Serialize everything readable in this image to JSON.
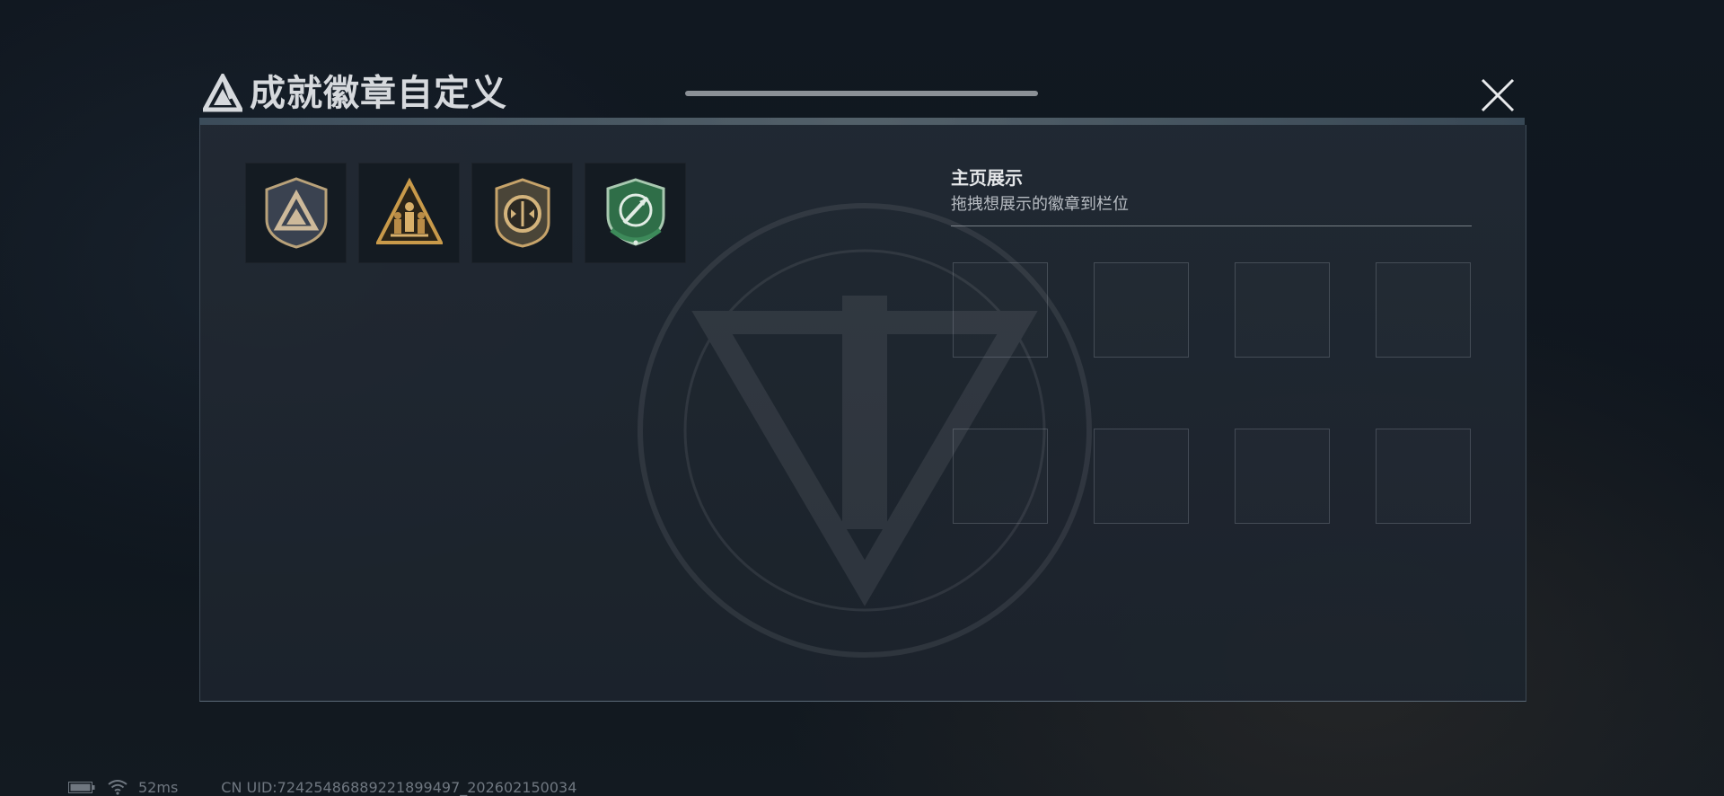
{
  "dialog": {
    "title": "成就徽章自定义",
    "close_icon": "close-icon",
    "logo_icon": "triangle-logo-icon"
  },
  "badges": [
    {
      "name": "triangle-shield-badge",
      "color": "#b9a27a"
    },
    {
      "name": "soldiers-triangle-badge",
      "color": "#c99a4a"
    },
    {
      "name": "oval-emblem-badge",
      "color": "#c6a36a"
    },
    {
      "name": "green-crest-badge",
      "color": "#3d8a5a"
    }
  ],
  "showcase": {
    "title": "主页展示",
    "subtitle": "拖拽想展示的徽章到栏位",
    "slots": 8
  },
  "status": {
    "ping": "52ms",
    "uid": "CN UID:72425486889221899497_202602150034"
  }
}
